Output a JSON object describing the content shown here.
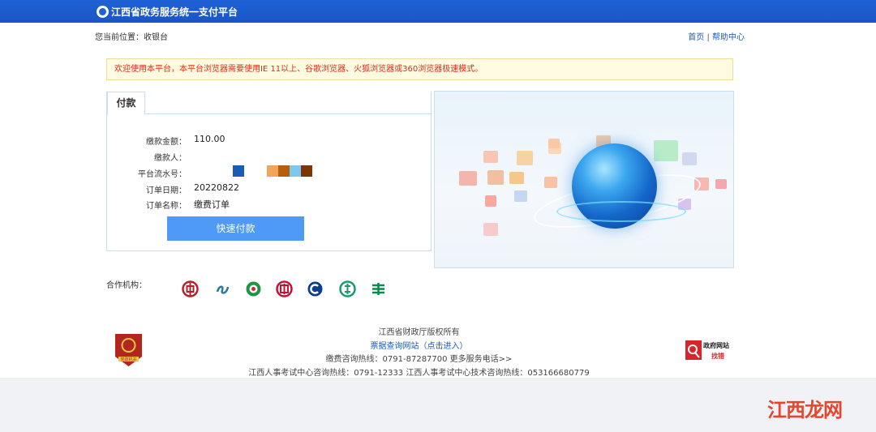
{
  "header": {
    "title": "江西省政务服务统一支付平台"
  },
  "breadcrumb": {
    "text": "您当前位置：收银台"
  },
  "toplinks": {
    "home": "首页",
    "sep": "|",
    "help": "帮助中心"
  },
  "notice": {
    "text": "欢迎使用本平台，本平台浏览器需要使用IE 11以上、谷歌浏览器、火狐浏览器或360浏览器极速模式。"
  },
  "payment": {
    "tab": "付款",
    "amount_label": "缴款金额：",
    "amount_value": "110.00",
    "payer_label": "缴款人：",
    "payer_value": "",
    "serial_label": "平台流水号：",
    "date_label": "订单日期：",
    "date_value": "20220822",
    "name_label": "订单名称：",
    "name_value": "缴费订单",
    "button": "快速付款"
  },
  "partners": {
    "label": "合作机构："
  },
  "footer": {
    "copyright": "江西省财政厅版权所有",
    "query_link": "票据查询网站（点击进入）",
    "hotline": "缴费咨询热线：0791-87287700    更多服务电话>>",
    "exam_hotline": "江西人事考试中心咨询热线：0791-12333    江西人事考试中心技术咨询热线：053166680779",
    "emblem_text": "党政机关",
    "badge_line1": "政府网站",
    "badge_line2": "找错"
  },
  "watermark": {
    "text": "江西龙网"
  },
  "colors": {
    "topbar": "#1f62d6",
    "notice_text": "#e0291b",
    "button": "#4e9af6",
    "link": "#1a5bc4"
  }
}
